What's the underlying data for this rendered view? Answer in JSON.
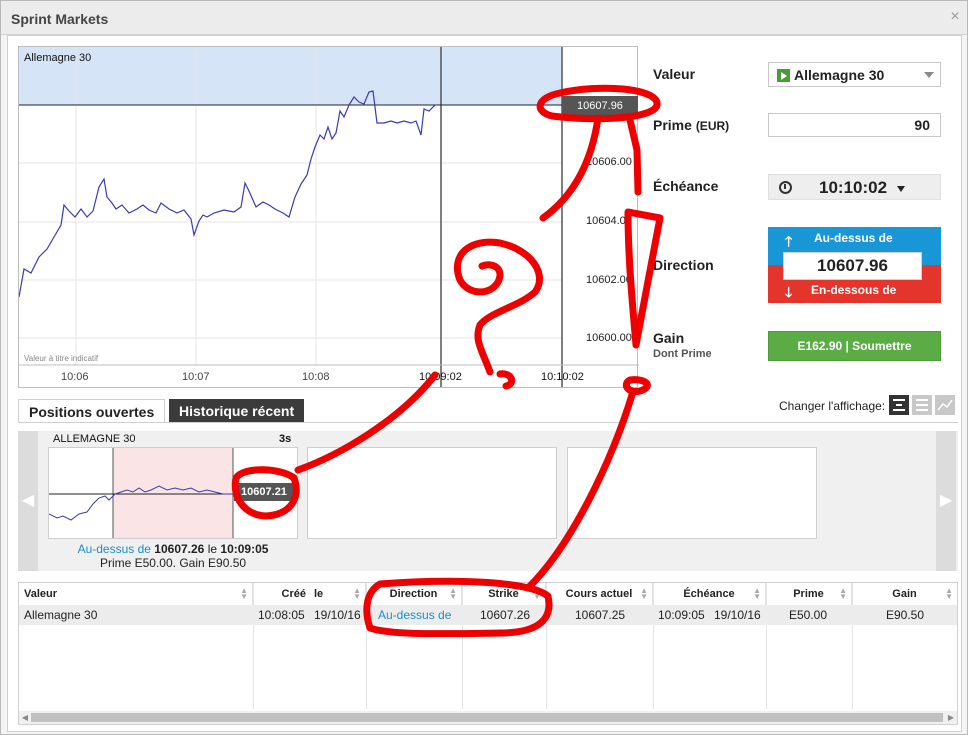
{
  "window": {
    "title": "Sprint Markets",
    "close_label": "×"
  },
  "chart": {
    "instrument": "Allemagne 30",
    "current_price": "10607.96",
    "disclaimer": "Valeur à titre indicatif",
    "y_ticks": [
      "10606.00",
      "10604.00",
      "10602.00",
      "10600.00"
    ],
    "x_ticks": [
      "10:06",
      "10:07",
      "10:08",
      "10:09:02",
      "10:10:02"
    ],
    "line_color": "#3a3ab0",
    "highlight_color": "#d6e4f7"
  },
  "form": {
    "valeur_label": "Valeur",
    "valeur_value": "Allemagne 30",
    "prime_label": "Prime",
    "prime_unit": "(EUR)",
    "prime_value": "90",
    "echeance_label": "Échéance",
    "echeance_value": "10:10:02",
    "direction_label": "Direction",
    "direction_up": "Au-dessus de",
    "direction_strike": "10607.96",
    "direction_down": "En-dessous de",
    "gain_label": "Gain",
    "gain_sub": "Dont Prime",
    "submit_label": "E162.90 | Soumettre",
    "up_color": "#1896d6",
    "down_color": "#e4352d",
    "submit_color": "#5cac45"
  },
  "tabs": [
    {
      "label": "Positions ouvertes",
      "active": true
    },
    {
      "label": "Historique récent",
      "active": false
    }
  ],
  "view_switch_label": "Changer l'affichage:",
  "position_card": {
    "instrument": "ALLEMAGNE 30",
    "countdown": "3s",
    "price_tag": "10607.21",
    "direction_text": "Au-dessus de",
    "strike": "10607.26",
    "at_word": "le",
    "time": "10:09:05",
    "prime_text": "Prime E50.00.",
    "gain_text": "Gain E90.50"
  },
  "table": {
    "columns": [
      "Valeur",
      "Créé",
      "le",
      "Direction",
      "Strike",
      "Cours actuel",
      "Échéance",
      "Prime",
      "Gain"
    ],
    "rows": [
      {
        "valeur": "Allemagne 30",
        "cree_time": "10:08:05",
        "cree_date": "19/10/16",
        "direction": "Au-dessus de",
        "strike": "10607.26",
        "cours": "10607.25",
        "echeance_time": "10:09:05",
        "echeance_date": "19/10/16",
        "prime": "E50.00",
        "gain": "E90.50"
      }
    ]
  },
  "annotation_color": "#ee0000"
}
